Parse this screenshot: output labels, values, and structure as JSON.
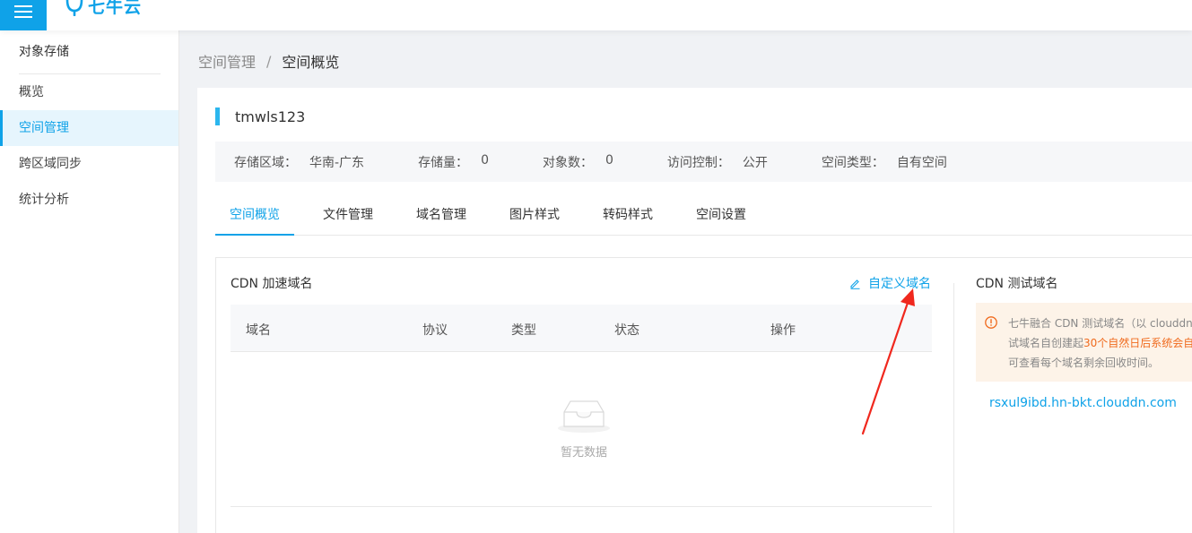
{
  "header": {
    "logo_text": "七牛云",
    "menu_icon": "hamburger-icon",
    "accent": "#0fa2e8"
  },
  "sidebar": {
    "title": "对象存储",
    "items": [
      {
        "label": "概览"
      },
      {
        "label": "空间管理",
        "active": true
      },
      {
        "label": "跨区域同步"
      },
      {
        "label": "统计分析"
      }
    ]
  },
  "breadcrumb": {
    "parent": "空间管理",
    "separator": "/",
    "current": "空间概览"
  },
  "bucket": {
    "name": "tmwls123",
    "info": [
      {
        "label": "存储区域：",
        "value": "华南-广东"
      },
      {
        "label": "存储量：",
        "value": "0"
      },
      {
        "label": "对象数：",
        "value": "0"
      },
      {
        "label": "访问控制：",
        "value": "公开"
      },
      {
        "label": "空间类型：",
        "value": "自有空间"
      }
    ]
  },
  "tabs": [
    {
      "label": "空间概览",
      "active": true
    },
    {
      "label": "文件管理"
    },
    {
      "label": "域名管理"
    },
    {
      "label": "图片样式"
    },
    {
      "label": "转码样式"
    },
    {
      "label": "空间设置"
    }
  ],
  "cdn": {
    "title": "CDN 加速域名",
    "custom_domain_link": "自定义域名",
    "columns": [
      "域名",
      "协议",
      "类型",
      "状态",
      "操作"
    ],
    "empty_text": "暂无数据"
  },
  "test_domain": {
    "title": "CDN 测试域名",
    "notice_line1": "七牛融合 CDN 测试域名（以 clouddn.c",
    "notice_line2_prefix": "试域名自创建起",
    "notice_line2_highlight": "30个自然日后系统会自",
    "notice_line3": "可查看每个域名剩余回收时间。",
    "domain": "rsxul9ibd.hn-bkt.clouddn.com",
    "warn_color": "#f06a1d"
  }
}
